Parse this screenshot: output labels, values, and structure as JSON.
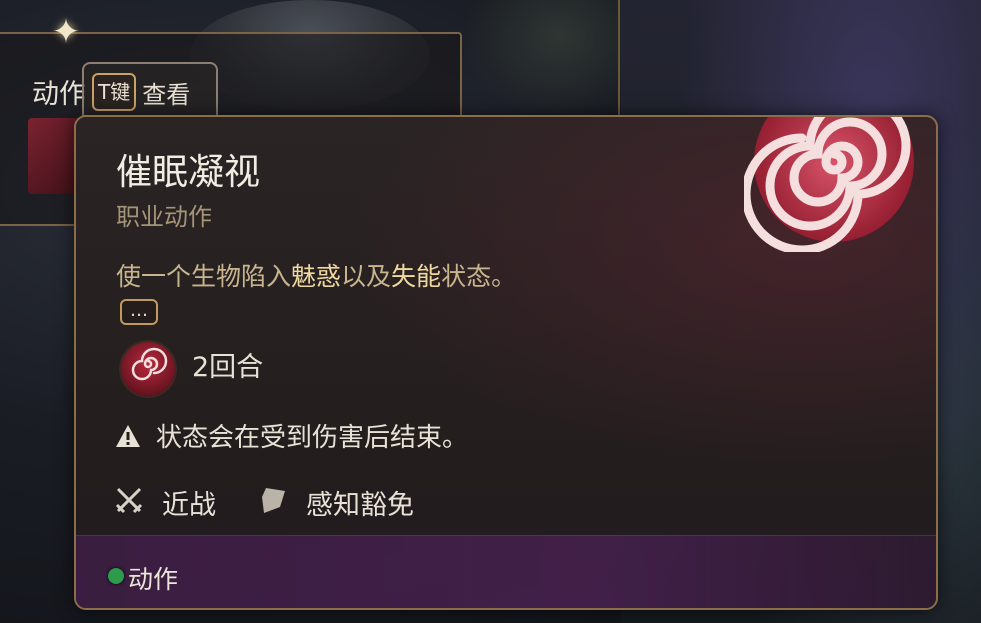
{
  "hotbar": {
    "section_label": "动作",
    "key_hint": "T键",
    "key_hint_action": "查看"
  },
  "tooltip": {
    "title": "催眠凝视",
    "subtitle": "职业动作",
    "description": {
      "prefix": "使一个生物陷入",
      "keyword1": "魅惑",
      "middle": "以及",
      "keyword2": "失能",
      "suffix": "状态。"
    },
    "more_label": "…",
    "duration": "2回合",
    "warning": "状态会在受到伤害后结束。",
    "tags": [
      {
        "icon": "crossed-swords-icon",
        "label": "近战"
      },
      {
        "icon": "shield-icon",
        "label": "感知豁免"
      }
    ],
    "footer": {
      "cost_label": "动作",
      "cost_color": "#2e9a4b"
    }
  },
  "colors": {
    "accent_gold": "#c09a5f",
    "keyword": "#f0d9a0",
    "spiral_red": "#b8293f"
  }
}
